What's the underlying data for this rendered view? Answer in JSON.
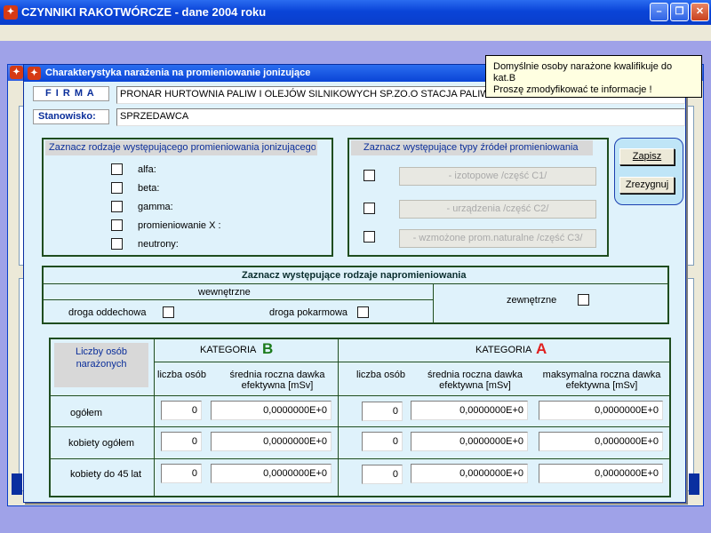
{
  "app": {
    "title": "CZYNNIKI RAKOTWÓRCZE  - dane 2004 roku"
  },
  "dialog": {
    "title": "Charakterystyka narażenia na promieniowanie jonizujące",
    "firma_label": "F I R M A",
    "firma_value": "PRONAR HURTOWNIA PALIW I OLEJÓW SILNIKOWYCH SP.ZO.O STACJA PALIW",
    "stanowisko_label": "Stanowisko:",
    "stanowisko_value": "SPRZEDAWCA"
  },
  "tooltip": {
    "line1": "Domyślnie osoby narażone kwalifikuje do kat.B",
    "line2": "Proszę zmodyfikować te informacje !"
  },
  "radiation_types": {
    "header": "Zaznacz rodzaje występującego promieniowania jonizującego",
    "items": [
      "alfa:",
      "beta:",
      "gamma:",
      "promieniowanie X :",
      "neutrony:"
    ]
  },
  "sources": {
    "header": "Zaznacz występujące typy źródeł promieniowania",
    "buttons": [
      "- izotopowe  /część C1/",
      "- urządzenia  /część C2/",
      "- wzmożone prom.naturalne  /część C3/"
    ]
  },
  "actions": {
    "save": "Zapisz",
    "cancel": "Zrezygnuj"
  },
  "exposure": {
    "header": "Zaznacz występujące rodzaje napromieniowania",
    "internal": "wewnętrzne",
    "inhalation": "droga oddechowa",
    "ingestion": "droga pokarmowa",
    "external": "zewnętrzne"
  },
  "table": {
    "corner_label": "Liczby osób narażonych",
    "category_label": "KATEGORIA",
    "cat_b_letter": "B",
    "cat_a_letter": "A",
    "cat_b_color": "#1a7a1a",
    "cat_a_color": "#e02020",
    "col_count": "liczba osób",
    "col_avg": "średnia roczna dawka efektywna [mSv]",
    "col_max": "maksymalna roczna dawka efektywna [mSv]",
    "rows": [
      {
        "label": "ogółem",
        "b_count": "0",
        "b_avg": "0,0000000E+0",
        "a_count": "0",
        "a_avg": "0,0000000E+0",
        "a_max": "0,0000000E+0"
      },
      {
        "label": "kobiety ogółem",
        "b_count": "0",
        "b_avg": "0,0000000E+0",
        "a_count": "0",
        "a_avg": "0,0000000E+0",
        "a_max": "0,0000000E+0"
      },
      {
        "label": "kobiety do 45 lat",
        "b_count": "0",
        "b_avg": "0,0000000E+0",
        "a_count": "0",
        "a_avg": "0,0000000E+0",
        "a_max": "0,0000000E+0"
      }
    ]
  }
}
